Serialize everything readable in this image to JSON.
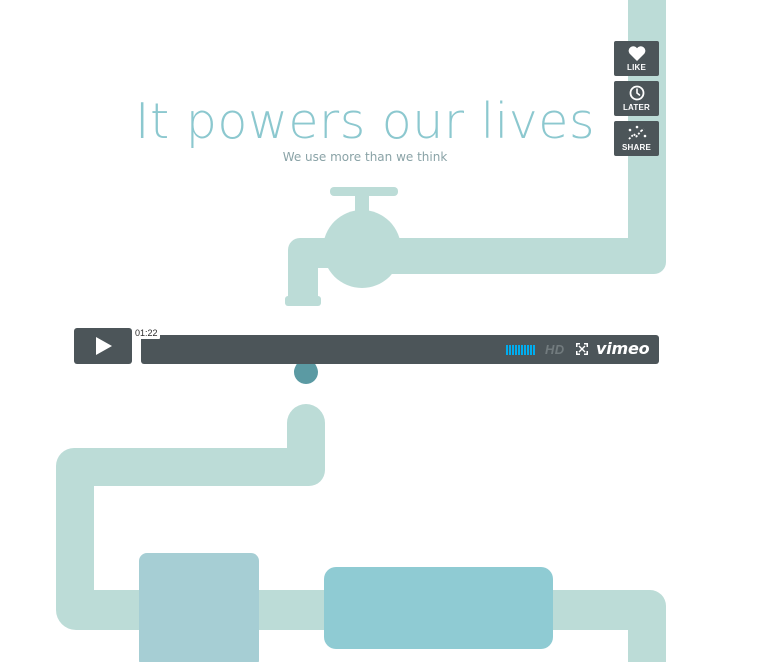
{
  "hero": {
    "title": "It powers our lives",
    "subtitle": "We use more than we think"
  },
  "side_buttons": [
    {
      "label": "LIKE",
      "icon": "heart-icon"
    },
    {
      "label": "LATER",
      "icon": "clock-icon"
    },
    {
      "label": "SHARE",
      "icon": "share-icon"
    }
  ],
  "player": {
    "play_icon": "play-icon",
    "timecode": "01:22",
    "hd_label": "HD",
    "fullscreen_icon": "fullscreen-icon",
    "brand": "vimeo"
  },
  "colors": {
    "pipe": "#bcdcd7",
    "tank_left": "#a6ced4",
    "tank_right": "#8fcbd3",
    "drop": "#5b9aa3",
    "controls": "#4c5559",
    "volume": "#00adef",
    "title": "#8cc8cf"
  }
}
